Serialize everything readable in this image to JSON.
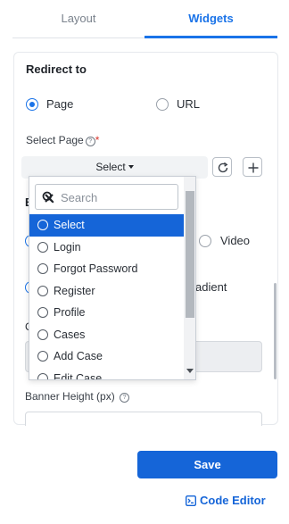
{
  "tabs": [
    {
      "label": "Layout",
      "active": false
    },
    {
      "label": "Widgets",
      "active": true
    }
  ],
  "redirect": {
    "title": "Redirect to",
    "options": [
      {
        "label": "Page",
        "selected": true
      },
      {
        "label": "URL",
        "selected": false
      }
    ]
  },
  "select_page": {
    "label": "Select Page",
    "required_mark": "*",
    "help_glyph": "?",
    "button_label": "Select",
    "refresh_icon": "refresh-icon",
    "add_icon": "plus-icon"
  },
  "dropdown": {
    "search_placeholder": "Search",
    "search_value": "",
    "options": [
      "Select",
      "Login",
      "Forgot Password",
      "Register",
      "Profile",
      "Cases",
      "Add Case",
      "Edit Case"
    ],
    "selected_index": 0
  },
  "background_fields": {
    "label_fragment": "B",
    "video_label": "Video",
    "gradient_fragment": "adient",
    "color_label_fragment": "C",
    "banner_height_label": "Banner Height (px)",
    "help_glyph": "?"
  },
  "footer": {
    "save_label": "Save",
    "code_editor_label": "Code Editor",
    "code_editor_icon": "terminal-icon"
  },
  "colors": {
    "accent": "#1a73e8",
    "primary_button": "#1565d8",
    "required": "#d9342b"
  }
}
